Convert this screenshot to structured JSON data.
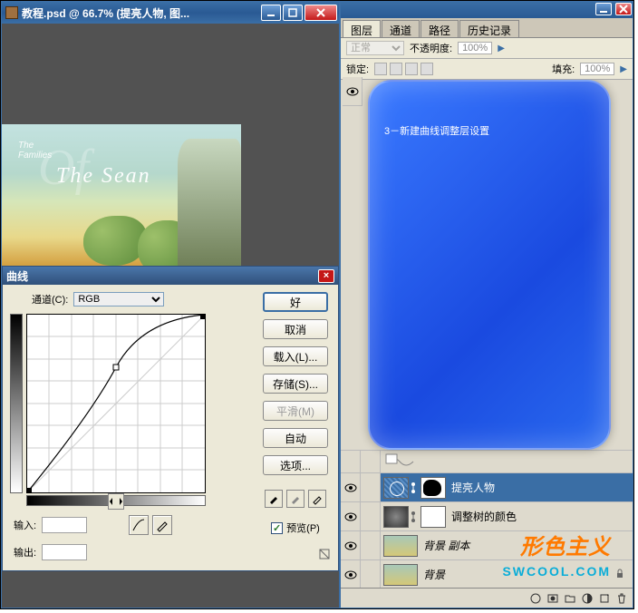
{
  "doc": {
    "title": "教程.psd @ 66.7% (提亮人物, 图..."
  },
  "curves": {
    "title": "曲线",
    "channel_label": "通道(C):",
    "channel_value": "RGB",
    "input_label": "输入:",
    "output_label": "输出:",
    "btn_ok": "好",
    "btn_cancel": "取消",
    "btn_load": "载入(L)...",
    "btn_save": "存储(S)...",
    "btn_smooth": "平滑(M)",
    "btn_auto": "自动",
    "btn_options": "选项...",
    "preview_label": "预览(P)"
  },
  "panel_tabs": [
    "图层",
    "通道",
    "路径",
    "历史记录"
  ],
  "blend": {
    "mode": "正常",
    "opacity_label": "不透明度:",
    "opacity": "100%",
    "lock_label": "锁定:",
    "fill_label": "填充:",
    "fill": "100%"
  },
  "annotation": "3－新建曲线调整层设置",
  "layers": {
    "l1": "提亮人物",
    "l2": "调整树的颜色",
    "l3": "背景 副本",
    "l4": "背景"
  },
  "watermark": {
    "top": "形色主义",
    "bottom": "SWCOOL.COM"
  },
  "chart_data": {
    "type": "line",
    "title": "Curves",
    "xlabel": "Input",
    "ylabel": "Output",
    "xlim": [
      0,
      255
    ],
    "ylim": [
      0,
      255
    ],
    "points": [
      [
        0,
        0
      ],
      [
        128,
        180
      ],
      [
        255,
        255
      ]
    ]
  }
}
